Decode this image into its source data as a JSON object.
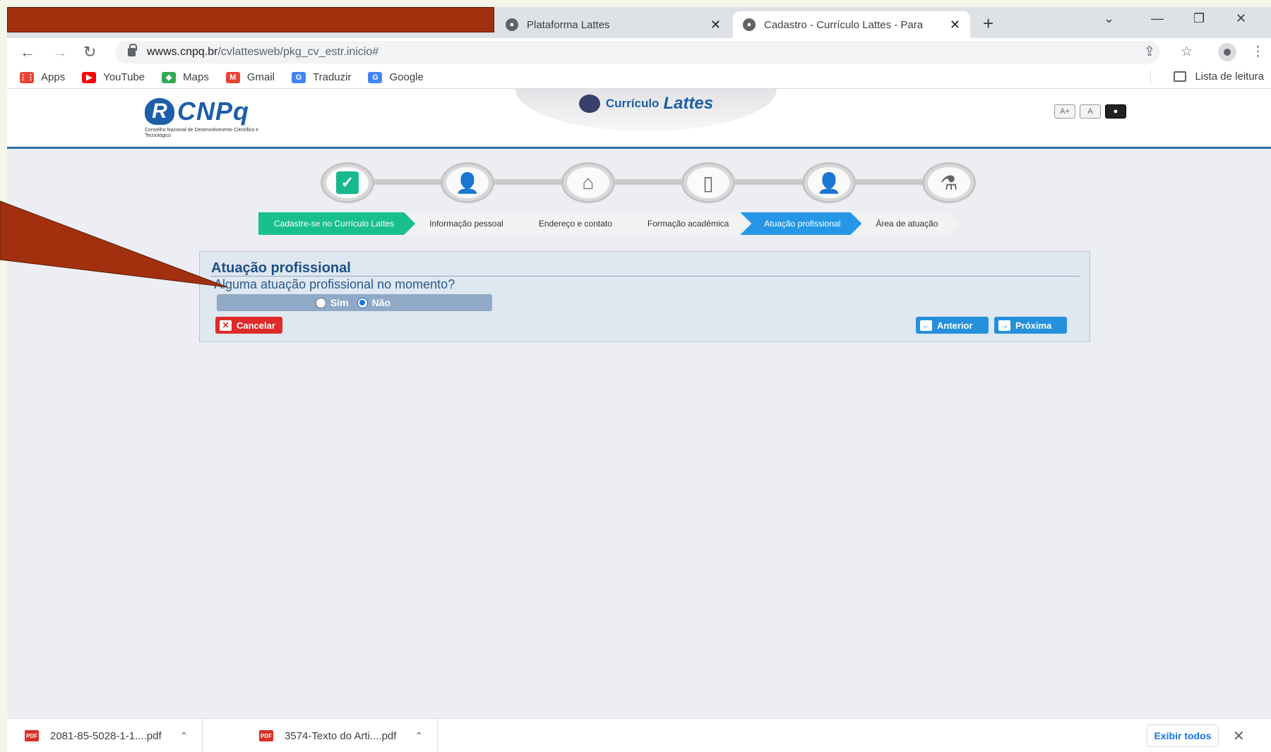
{
  "browser": {
    "tabs": [
      {
        "title": "Plataforma Lattes",
        "active": false
      },
      {
        "title": "Cadastro - Currículo Lattes - Para",
        "active": true
      }
    ],
    "new_tab_icon": "+",
    "window_controls": {
      "dropdown": "⌄",
      "minimize": "—",
      "restore": "❐",
      "close": "✕"
    },
    "url_host": "wwws.cnpq.br",
    "url_path": "/cvlattesweb/pkg_cv_estr.inicio#",
    "bookmarks": [
      {
        "label": "Apps",
        "color": "#ea4335"
      },
      {
        "label": "YouTube",
        "color": "#ff0000"
      },
      {
        "label": "Maps",
        "color": "#34a853"
      },
      {
        "label": "Gmail",
        "color": "#ea4335"
      },
      {
        "label": "Traduzir",
        "color": "#4285f4"
      },
      {
        "label": "Google",
        "color": "#4285f4"
      }
    ],
    "reading_list": "Lista de leitura"
  },
  "site": {
    "logo_text": "CNPq",
    "logo_subtitle": "Conselho Nacional de Desenvolvimento Científico e Tecnológico",
    "product_small": "Currículo",
    "product_big": "Lattes",
    "font_controls": [
      "A+",
      "A",
      "●"
    ]
  },
  "steps": [
    {
      "label": "Cadastre-se no Currículo Lattes",
      "state": "done",
      "icon": "form-check-icon"
    },
    {
      "label": "Informação pessoal",
      "state": "todo",
      "icon": "person-icon"
    },
    {
      "label": "Endereço e contato",
      "state": "todo",
      "icon": "house-icon"
    },
    {
      "label": "Formação acadêmica",
      "state": "todo",
      "icon": "book-icon"
    },
    {
      "label": "Atuação profissional",
      "state": "current",
      "icon": "professional-icon"
    },
    {
      "label": "Área de atuação",
      "state": "todo",
      "icon": "flask-icon"
    }
  ],
  "form": {
    "title": "Atuação profissional",
    "question": "Alguma atuação profissional no momento?",
    "option_yes": "Sim",
    "option_no": "Não",
    "selected": "Não",
    "cancel_label": "Cancelar",
    "prev_label": "Anterior",
    "next_label": "Próxima"
  },
  "downloads": [
    {
      "name": "2081-85-5028-1-1....pdf"
    },
    {
      "name": "3574-Texto do Arti....pdf"
    }
  ],
  "downloads_show_all": "Exibir todos",
  "colors": {
    "annotation": "#a2300f",
    "done_step": "#19c08d",
    "current_step": "#2697e6",
    "cancel": "#e02a2a"
  }
}
